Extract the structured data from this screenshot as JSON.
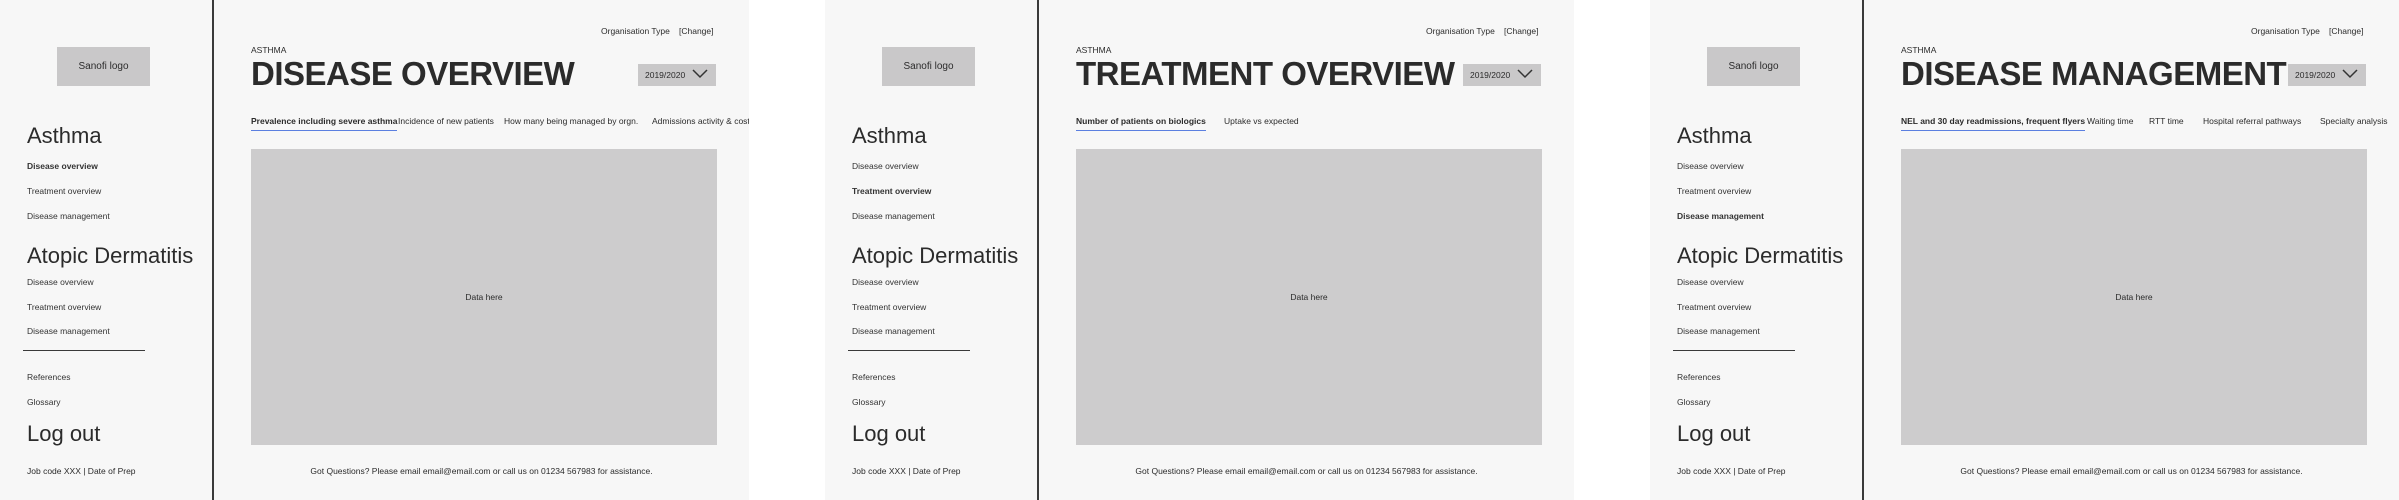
{
  "sidebar": {
    "logo_text": "Sanofi logo",
    "asthma_title": "Asthma",
    "asthma_items": [
      "Disease overview",
      "Treatment overview",
      "Disease management"
    ],
    "ad_title": "Atopic Dermatitis",
    "ad_items": [
      "Disease overview",
      "Treatment overview",
      "Disease management"
    ],
    "references": "References",
    "glossary": "Glossary",
    "logout": "Log out",
    "job_code": "Job code XXX | Date of Prep"
  },
  "header": {
    "org_type_label": "Organisation Type",
    "change_link": "[Change]",
    "breadcrumb": "ASTHMA",
    "year_select": "2019/2020"
  },
  "data_placeholder": "Data here",
  "footer_text": "Got Questions? Please email email@email.com or call us on 01234 567983 for assistance.",
  "screens": [
    {
      "title": "DISEASE OVERVIEW",
      "active_nav": 0,
      "tabs": [
        "Prevalence including severe asthma",
        "Incidence of new patients",
        "How many being managed by orgn.",
        "Admissions activity & cost"
      ]
    },
    {
      "title": "TREATMENT OVERVIEW",
      "active_nav": 1,
      "tabs": [
        "Number of patients on biologics",
        "Uptake vs expected"
      ]
    },
    {
      "title": "DISEASE MANAGEMENT",
      "active_nav": 2,
      "tabs": [
        "NEL and 30 day readmissions, frequent flyers",
        "Waiting time",
        "RTT time",
        "Hospital referral pathways",
        "Specialty analysis"
      ]
    }
  ]
}
